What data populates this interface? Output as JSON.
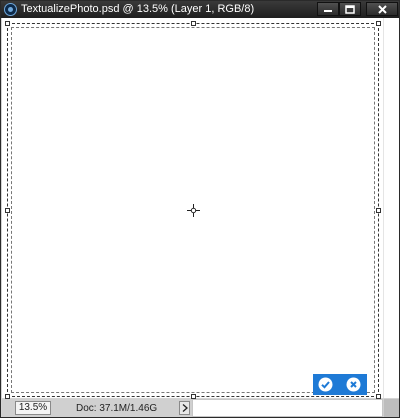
{
  "window": {
    "title": "TextualizePhoto.psd @ 13.5% (Layer 1, RGB/8)",
    "controls": {
      "minimize_icon": "minimize-icon",
      "maximize_icon": "maximize-icon",
      "close_icon": "close-icon"
    }
  },
  "canvas": {
    "background": "#ffffff",
    "transform": {
      "center_icon": "crosshair-icon",
      "commit_icon": "checkmark-icon",
      "cancel_icon": "cancel-icon",
      "accent_color": "#1e7ad6"
    }
  },
  "status_bar": {
    "zoom": "13.5%",
    "doc_info": "Doc: 37.1M/1.46G",
    "menu_arrow_icon": "chevron-right-icon"
  }
}
